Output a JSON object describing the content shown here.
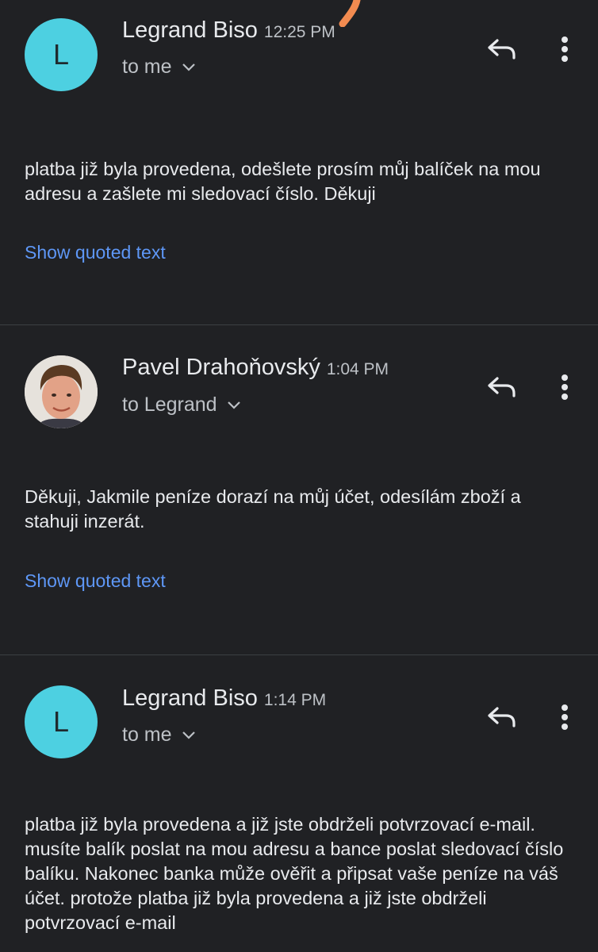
{
  "messages": [
    {
      "avatar_letter": "L",
      "avatar_color": "#4dd0e1",
      "sender": "Legrand Biso",
      "time": "12:25 PM",
      "recipient": "to me",
      "body": "platba již byla provedena, odešlete prosím můj balíček na mou adresu a zašlete mi sledovací číslo. Děkuji",
      "show_quoted": "Show quoted text"
    },
    {
      "avatar_type": "photo",
      "sender": "Pavel Drahoňovský",
      "time": "1:04 PM",
      "recipient": "to Legrand",
      "body": "Děkuji, Jakmile peníze dorazí na můj účet, odesílám zboží a stahuji inzerát.",
      "show_quoted": "Show quoted text"
    },
    {
      "avatar_letter": "L",
      "avatar_color": "#4dd0e1",
      "sender": "Legrand Biso",
      "time": "1:14 PM",
      "recipient": "to me",
      "body": "platba již byla provedena a již jste obdrželi potvrzovací e-mail. musíte balík poslat na mou adresu a bance poslat sledovací číslo balíku. Nakonec banka může ověřit a připsat vaše peníze na váš účet. protože platba již byla provedena a již jste obdrželi potvrzovací e-mail"
    }
  ],
  "colors": {
    "background": "#202124",
    "link": "#5e97f6",
    "divider": "#3c4043",
    "annotation": "#f28b50"
  },
  "icons": {
    "reply": "reply-icon",
    "more": "more-vert-icon",
    "expand": "chevron-down-icon"
  }
}
